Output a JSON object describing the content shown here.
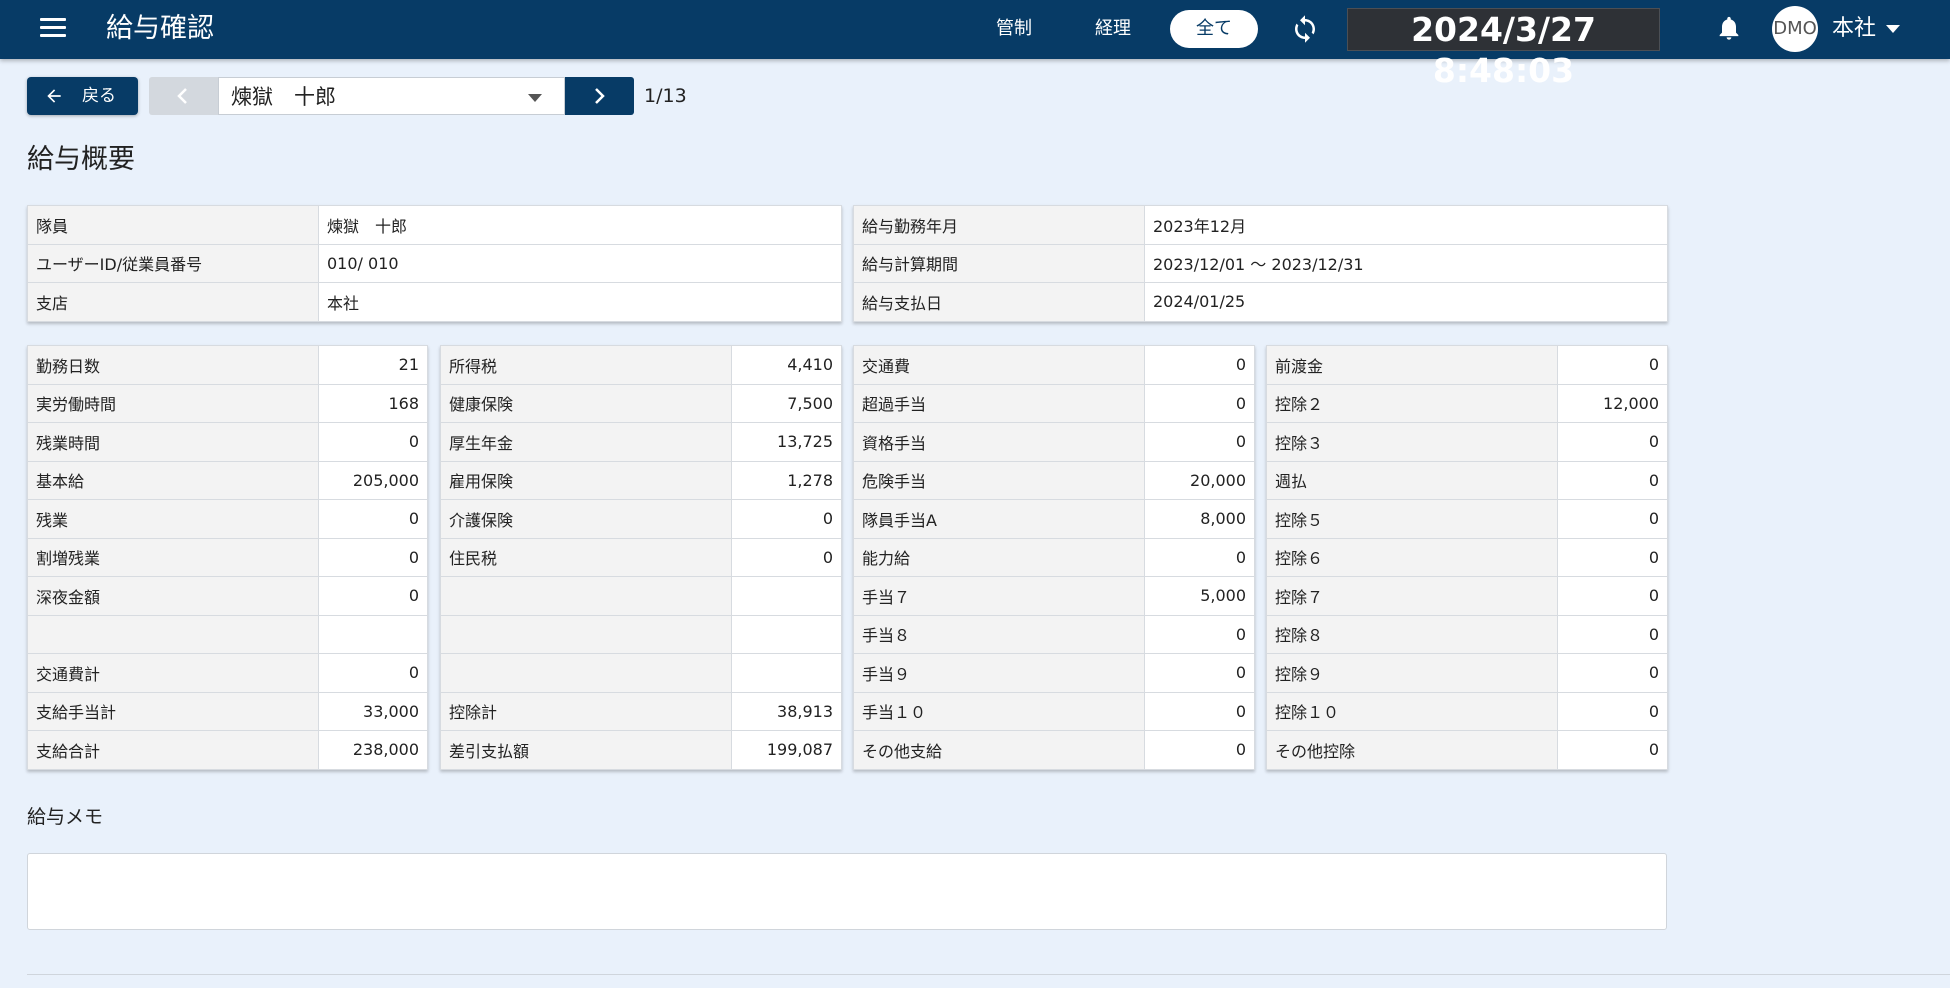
{
  "header": {
    "title": "給与確認",
    "nav": [
      "管制",
      "経理"
    ],
    "nav_active": "全て",
    "clock": "2024/3/27 8:48:03",
    "avatar": "DMO",
    "user": "本社"
  },
  "toolbar": {
    "back_label": "戻る",
    "employee_selected": "煉獄　十郎",
    "pager": "1/13"
  },
  "section_title": "給与概要",
  "info_left": [
    {
      "label": "隊員",
      "value": "煉獄　十郎"
    },
    {
      "label": "ユーザーID/従業員番号",
      "value": "010/ 010"
    },
    {
      "label": "支店",
      "value": "本社"
    }
  ],
  "info_right": [
    {
      "label": "給与勤務年月",
      "value": "2023年12月"
    },
    {
      "label": "給与計算期間",
      "value": "2023/12/01 ～ 2023/12/31"
    },
    {
      "label": "給与支払日",
      "value": "2024/01/25"
    }
  ],
  "payroll_tables": [
    [
      {
        "label": "勤務日数",
        "value": "21"
      },
      {
        "label": "実労働時間",
        "value": "168"
      },
      {
        "label": "残業時間",
        "value": "0"
      },
      {
        "label": "基本給",
        "value": "205,000"
      },
      {
        "label": "残業",
        "value": "0"
      },
      {
        "label": "割増残業",
        "value": "0"
      },
      {
        "label": "深夜金額",
        "value": "0"
      },
      {
        "label": "",
        "value": ""
      },
      {
        "label": "交通費計",
        "value": "0"
      },
      {
        "label": "支給手当計",
        "value": "33,000"
      },
      {
        "label": "支給合計",
        "value": "238,000"
      }
    ],
    [
      {
        "label": "所得税",
        "value": "4,410"
      },
      {
        "label": "健康保険",
        "value": "7,500"
      },
      {
        "label": "厚生年金",
        "value": "13,725"
      },
      {
        "label": "雇用保険",
        "value": "1,278"
      },
      {
        "label": "介護保険",
        "value": "0"
      },
      {
        "label": "住民税",
        "value": "0"
      },
      {
        "label": "",
        "value": ""
      },
      {
        "label": "",
        "value": ""
      },
      {
        "label": "",
        "value": ""
      },
      {
        "label": "控除計",
        "value": "38,913"
      },
      {
        "label": "差引支払額",
        "value": "199,087"
      }
    ],
    [
      {
        "label": "交通費",
        "value": "0"
      },
      {
        "label": "超過手当",
        "value": "0"
      },
      {
        "label": "資格手当",
        "value": "0"
      },
      {
        "label": "危険手当",
        "value": "20,000"
      },
      {
        "label": "隊員手当A",
        "value": "8,000"
      },
      {
        "label": "能力給",
        "value": "0"
      },
      {
        "label": "手当７",
        "value": "5,000"
      },
      {
        "label": "手当８",
        "value": "0"
      },
      {
        "label": "手当９",
        "value": "0"
      },
      {
        "label": "手当１０",
        "value": "0"
      },
      {
        "label": "その他支給",
        "value": "0"
      }
    ],
    [
      {
        "label": "前渡金",
        "value": "0"
      },
      {
        "label": "控除２",
        "value": "12,000"
      },
      {
        "label": "控除３",
        "value": "0"
      },
      {
        "label": "週払",
        "value": "0"
      },
      {
        "label": "控除５",
        "value": "0"
      },
      {
        "label": "控除６",
        "value": "0"
      },
      {
        "label": "控除７",
        "value": "0"
      },
      {
        "label": "控除８",
        "value": "0"
      },
      {
        "label": "控除９",
        "value": "0"
      },
      {
        "label": "控除１０",
        "value": "0"
      },
      {
        "label": "その他控除",
        "value": "0"
      }
    ]
  ],
  "memo": {
    "label": "給与メモ",
    "value": ""
  },
  "icons": {
    "menu": "menu-icon",
    "sync": "sync-icon",
    "bell": "bell-icon",
    "back": "arrow-left-icon",
    "prev": "chevron-left-icon",
    "next": "chevron-right-icon",
    "dropdown": "caret-down-icon"
  },
  "colors": {
    "header_bg": "#073b66",
    "page_bg": "#e9f1fb",
    "label_cell_bg": "#f3f3f3",
    "clock_bg": "#2e3136"
  }
}
